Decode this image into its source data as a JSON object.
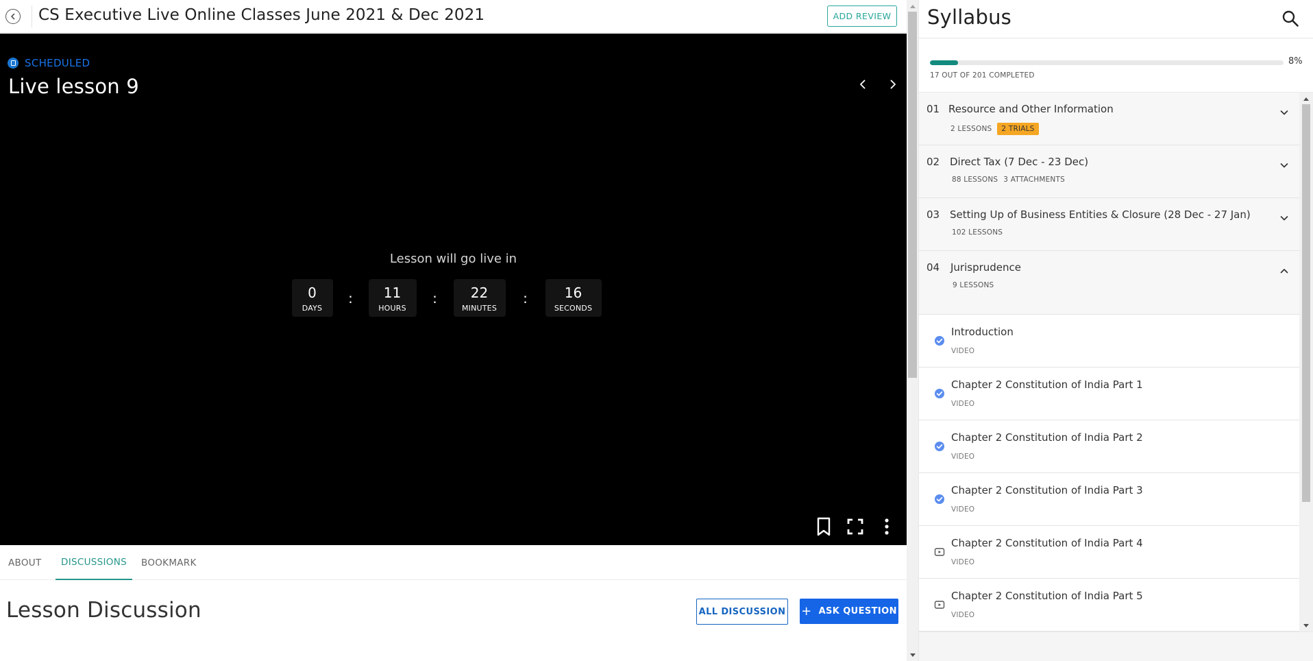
{
  "header": {
    "course_title": "CS Executive Live Online Classes June 2021 & Dec 2021",
    "add_review_label": "ADD REVIEW"
  },
  "player": {
    "status": "SCHEDULED",
    "lesson_title": "Live lesson 9",
    "countdown_label": "Lesson will go live in",
    "countdown": [
      {
        "value": "0",
        "unit": "DAYS"
      },
      {
        "value": "11",
        "unit": "HOURS"
      },
      {
        "value": "22",
        "unit": "MINUTES"
      },
      {
        "value": "16",
        "unit": "SECONDS"
      }
    ],
    "separator": ":",
    "controls": [
      "bookmark-icon",
      "fullscreen-icon",
      "more-vertical-icon"
    ]
  },
  "tabs": [
    {
      "label": "ABOUT",
      "active": false
    },
    {
      "label": "DISCUSSIONS",
      "active": true
    },
    {
      "label": "BOOKMARK",
      "active": false
    }
  ],
  "discussion": {
    "title": "Lesson Discussion",
    "all_discussion_label": "ALL DISCUSSION",
    "ask_question_label": "ASK QUESTION"
  },
  "syllabus": {
    "title": "Syllabus",
    "progress_percent_label": "8%",
    "progress_fraction": 0.08,
    "progress_count_label": "17 OUT OF 201 COMPLETED",
    "sections": [
      {
        "num": "01",
        "title": "Resource and Other Information",
        "meta": [
          "2 LESSONS"
        ],
        "badge": "2 TRIALS",
        "open": false
      },
      {
        "num": "02",
        "title": "Direct Tax (7 Dec - 23 Dec)",
        "meta": [
          "88 LESSONS",
          "3 ATTACHMENTS"
        ],
        "badge": "",
        "open": false
      },
      {
        "num": "03",
        "title": "Setting Up of Business Entities & Closure (28 Dec - 27 Jan)",
        "meta": [
          "102 LESSONS"
        ],
        "badge": "",
        "open": false
      },
      {
        "num": "04",
        "title": "Jurisprudence",
        "meta": [
          "9 LESSONS"
        ],
        "badge": "",
        "open": true
      }
    ],
    "lessons": [
      {
        "title": "Introduction",
        "type": "VIDEO",
        "completed": true
      },
      {
        "title": "Chapter 2 Constitution of India Part 1",
        "type": "VIDEO",
        "completed": true
      },
      {
        "title": "Chapter 2 Constitution of India Part 2",
        "type": "VIDEO",
        "completed": true
      },
      {
        "title": "Chapter 2 Constitution of India Part 3",
        "type": "VIDEO",
        "completed": true
      },
      {
        "title": "Chapter 2 Constitution of India Part 4",
        "type": "VIDEO",
        "completed": false
      },
      {
        "title": "Chapter 2 Constitution of India Part 5",
        "type": "VIDEO",
        "completed": false
      }
    ]
  },
  "colors": {
    "accent_teal": "#26968b",
    "progress_fill": "#128a7e",
    "primary_blue": "#1565e6",
    "status_blue": "#1a73e8",
    "trial_badge": "#f5a623",
    "check_blue": "#5b8def"
  }
}
